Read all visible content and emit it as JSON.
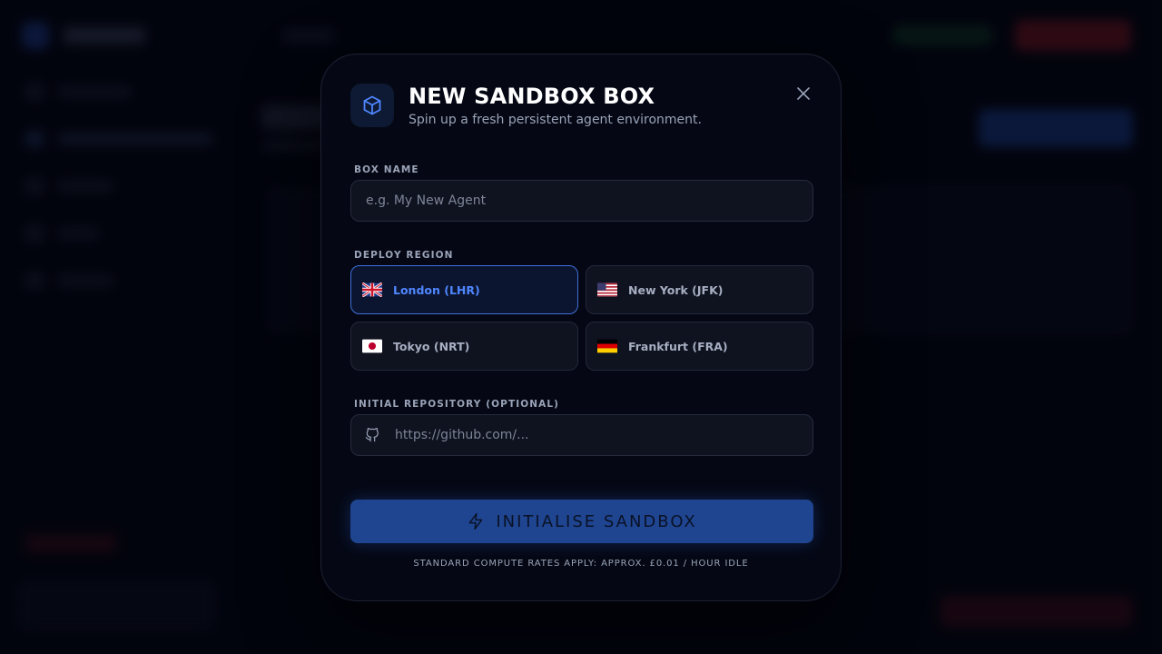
{
  "modal": {
    "title": "NEW SANDBOX BOX",
    "subtitle": "Spin up a fresh persistent agent environment.",
    "icon": "cube-icon",
    "close_icon": "close-icon"
  },
  "form": {
    "box_name": {
      "label": "BOX NAME",
      "value": "",
      "placeholder": "e.g. My New Agent"
    },
    "region": {
      "label": "DEPLOY REGION",
      "selected": "London (LHR)",
      "options": [
        {
          "label": "London (LHR)",
          "flag": "uk-flag-icon",
          "selected": true
        },
        {
          "label": "New York (JFK)",
          "flag": "us-flag-icon",
          "selected": false
        },
        {
          "label": "Tokyo (NRT)",
          "flag": "japan-flag-icon",
          "selected": false
        },
        {
          "label": "Frankfurt (FRA)",
          "flag": "germany-flag-icon",
          "selected": false
        }
      ]
    },
    "repository": {
      "label": "INITIAL REPOSITORY (OPTIONAL)",
      "value": "",
      "placeholder": "https://github.com/...",
      "icon": "github-icon"
    },
    "submit": {
      "label": "INITIALISE SANDBOX",
      "icon": "lightning-bolt-icon"
    },
    "footnote": "STANDARD COMPUTE RATES APPLY: APPROX. £0.01 / HOUR IDLE"
  },
  "colors": {
    "accent": "#4f86ff",
    "selected_border": "#3f6fd8",
    "submit_bg": "#1f4591",
    "modal_bg": "#050814"
  }
}
